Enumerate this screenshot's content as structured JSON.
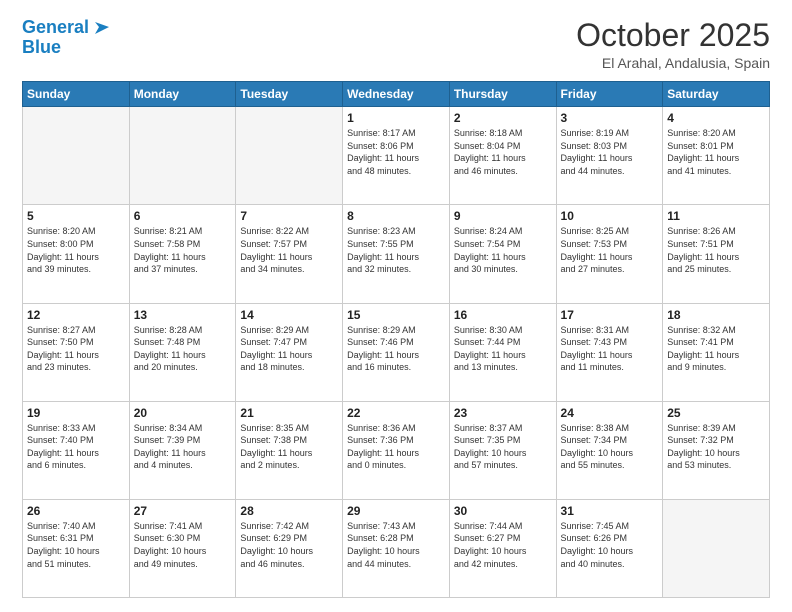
{
  "logo": {
    "line1": "General",
    "line2": "Blue"
  },
  "header": {
    "month": "October 2025",
    "location": "El Arahal, Andalusia, Spain"
  },
  "days_of_week": [
    "Sunday",
    "Monday",
    "Tuesday",
    "Wednesday",
    "Thursday",
    "Friday",
    "Saturday"
  ],
  "weeks": [
    [
      {
        "day": "",
        "info": ""
      },
      {
        "day": "",
        "info": ""
      },
      {
        "day": "",
        "info": ""
      },
      {
        "day": "1",
        "info": "Sunrise: 8:17 AM\nSunset: 8:06 PM\nDaylight: 11 hours\nand 48 minutes."
      },
      {
        "day": "2",
        "info": "Sunrise: 8:18 AM\nSunset: 8:04 PM\nDaylight: 11 hours\nand 46 minutes."
      },
      {
        "day": "3",
        "info": "Sunrise: 8:19 AM\nSunset: 8:03 PM\nDaylight: 11 hours\nand 44 minutes."
      },
      {
        "day": "4",
        "info": "Sunrise: 8:20 AM\nSunset: 8:01 PM\nDaylight: 11 hours\nand 41 minutes."
      }
    ],
    [
      {
        "day": "5",
        "info": "Sunrise: 8:20 AM\nSunset: 8:00 PM\nDaylight: 11 hours\nand 39 minutes."
      },
      {
        "day": "6",
        "info": "Sunrise: 8:21 AM\nSunset: 7:58 PM\nDaylight: 11 hours\nand 37 minutes."
      },
      {
        "day": "7",
        "info": "Sunrise: 8:22 AM\nSunset: 7:57 PM\nDaylight: 11 hours\nand 34 minutes."
      },
      {
        "day": "8",
        "info": "Sunrise: 8:23 AM\nSunset: 7:55 PM\nDaylight: 11 hours\nand 32 minutes."
      },
      {
        "day": "9",
        "info": "Sunrise: 8:24 AM\nSunset: 7:54 PM\nDaylight: 11 hours\nand 30 minutes."
      },
      {
        "day": "10",
        "info": "Sunrise: 8:25 AM\nSunset: 7:53 PM\nDaylight: 11 hours\nand 27 minutes."
      },
      {
        "day": "11",
        "info": "Sunrise: 8:26 AM\nSunset: 7:51 PM\nDaylight: 11 hours\nand 25 minutes."
      }
    ],
    [
      {
        "day": "12",
        "info": "Sunrise: 8:27 AM\nSunset: 7:50 PM\nDaylight: 11 hours\nand 23 minutes."
      },
      {
        "day": "13",
        "info": "Sunrise: 8:28 AM\nSunset: 7:48 PM\nDaylight: 11 hours\nand 20 minutes."
      },
      {
        "day": "14",
        "info": "Sunrise: 8:29 AM\nSunset: 7:47 PM\nDaylight: 11 hours\nand 18 minutes."
      },
      {
        "day": "15",
        "info": "Sunrise: 8:29 AM\nSunset: 7:46 PM\nDaylight: 11 hours\nand 16 minutes."
      },
      {
        "day": "16",
        "info": "Sunrise: 8:30 AM\nSunset: 7:44 PM\nDaylight: 11 hours\nand 13 minutes."
      },
      {
        "day": "17",
        "info": "Sunrise: 8:31 AM\nSunset: 7:43 PM\nDaylight: 11 hours\nand 11 minutes."
      },
      {
        "day": "18",
        "info": "Sunrise: 8:32 AM\nSunset: 7:41 PM\nDaylight: 11 hours\nand 9 minutes."
      }
    ],
    [
      {
        "day": "19",
        "info": "Sunrise: 8:33 AM\nSunset: 7:40 PM\nDaylight: 11 hours\nand 6 minutes."
      },
      {
        "day": "20",
        "info": "Sunrise: 8:34 AM\nSunset: 7:39 PM\nDaylight: 11 hours\nand 4 minutes."
      },
      {
        "day": "21",
        "info": "Sunrise: 8:35 AM\nSunset: 7:38 PM\nDaylight: 11 hours\nand 2 minutes."
      },
      {
        "day": "22",
        "info": "Sunrise: 8:36 AM\nSunset: 7:36 PM\nDaylight: 11 hours\nand 0 minutes."
      },
      {
        "day": "23",
        "info": "Sunrise: 8:37 AM\nSunset: 7:35 PM\nDaylight: 10 hours\nand 57 minutes."
      },
      {
        "day": "24",
        "info": "Sunrise: 8:38 AM\nSunset: 7:34 PM\nDaylight: 10 hours\nand 55 minutes."
      },
      {
        "day": "25",
        "info": "Sunrise: 8:39 AM\nSunset: 7:32 PM\nDaylight: 10 hours\nand 53 minutes."
      }
    ],
    [
      {
        "day": "26",
        "info": "Sunrise: 7:40 AM\nSunset: 6:31 PM\nDaylight: 10 hours\nand 51 minutes."
      },
      {
        "day": "27",
        "info": "Sunrise: 7:41 AM\nSunset: 6:30 PM\nDaylight: 10 hours\nand 49 minutes."
      },
      {
        "day": "28",
        "info": "Sunrise: 7:42 AM\nSunset: 6:29 PM\nDaylight: 10 hours\nand 46 minutes."
      },
      {
        "day": "29",
        "info": "Sunrise: 7:43 AM\nSunset: 6:28 PM\nDaylight: 10 hours\nand 44 minutes."
      },
      {
        "day": "30",
        "info": "Sunrise: 7:44 AM\nSunset: 6:27 PM\nDaylight: 10 hours\nand 42 minutes."
      },
      {
        "day": "31",
        "info": "Sunrise: 7:45 AM\nSunset: 6:26 PM\nDaylight: 10 hours\nand 40 minutes."
      },
      {
        "day": "",
        "info": ""
      }
    ]
  ]
}
